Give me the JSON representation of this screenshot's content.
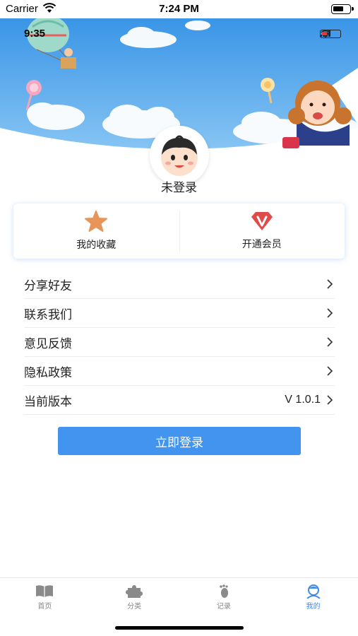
{
  "status_bar": {
    "carrier": "Carrier",
    "time": "7:24 PM"
  },
  "header": {
    "inner_time": "9:35"
  },
  "profile": {
    "login_status": "未登录"
  },
  "quick_actions": [
    {
      "label": "我的收藏",
      "icon": "star-icon",
      "color": "#e8955a"
    },
    {
      "label": "开通会员",
      "icon": "vip-diamond-icon",
      "color": "#e04a4a"
    }
  ],
  "menu": [
    {
      "title": "分享好友",
      "value": ""
    },
    {
      "title": "联系我们",
      "value": ""
    },
    {
      "title": "意见反馈",
      "value": ""
    },
    {
      "title": "隐私政策",
      "value": ""
    },
    {
      "title": "当前版本",
      "value": "V 1.0.1"
    }
  ],
  "login_button": {
    "label": "立即登录",
    "color": "#4294ee"
  },
  "tabs": [
    {
      "label": "首页",
      "icon": "book-icon",
      "active": false
    },
    {
      "label": "分类",
      "icon": "puzzle-icon",
      "active": false
    },
    {
      "label": "记录",
      "icon": "footprint-icon",
      "active": false
    },
    {
      "label": "我的",
      "icon": "user-icon",
      "active": true
    }
  ],
  "colors": {
    "accent": "#4294ee",
    "active_tab": "#3f8ae6",
    "header_sky": "#3f9ae8"
  }
}
